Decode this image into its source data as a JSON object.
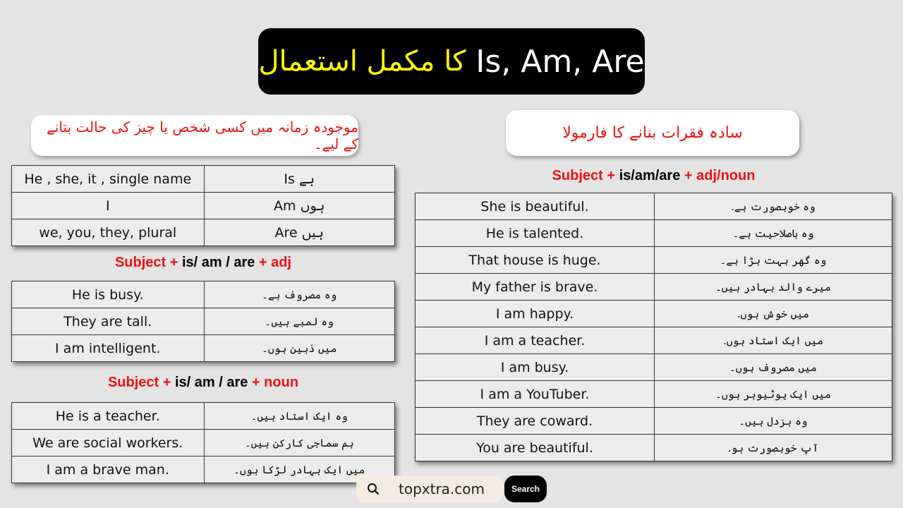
{
  "title": {
    "urdu": "کا مکمل استعمال",
    "english": "Is, Am, Are"
  },
  "left_banner": "موجودہ زمانہ میں کسی شخص یا چیز کی حالت بتانے کے لیے۔",
  "right_banner": "سادہ فقرات بنانے کا فارمولا",
  "usage_table": {
    "rows": [
      {
        "subject": "He , she, it , single name",
        "verb": "Is ہے"
      },
      {
        "subject": "I",
        "verb": "Am ہوں"
      },
      {
        "subject": "we, you, they, plural",
        "verb": "Are ہیں"
      }
    ]
  },
  "adj_section": {
    "formula": {
      "part1": "Subject +",
      "part2": " is/ am / are ",
      "part3": "+ adj"
    },
    "rows": [
      {
        "en": "He is busy.",
        "ur": "وہ مصروف ہے۔"
      },
      {
        "en": "They are tall.",
        "ur": "وہ لمبے ہیں۔"
      },
      {
        "en": "I am intelligent.",
        "ur": "میں ذہین ہوں۔"
      }
    ]
  },
  "noun_section": {
    "formula": {
      "part1": "Subject +",
      "part2": " is/ am / are ",
      "part3": "+ noun"
    },
    "rows": [
      {
        "en": "He is a teacher.",
        "ur": "وہ ایک استاد ہیں۔"
      },
      {
        "en": "We are social workers.",
        "ur": "ہم سماجی کارکن ہیں۔"
      },
      {
        "en": "I am a brave man.",
        "ur": "میں ایک بہادر لڑکا ہوں۔"
      }
    ]
  },
  "examples_section": {
    "formula": {
      "part1": "Subject +",
      "part2": " is/am/are ",
      "part3": "+ adj/noun"
    },
    "rows": [
      {
        "en": "She is beautiful.",
        "ur": "وہ خوبصورت ہے."
      },
      {
        "en": "He is talented.",
        "ur": "وہ باصلاحیت ہے۔"
      },
      {
        "en": "That house is huge.",
        "ur": "وہ گھر بہت بڑا ہے۔"
      },
      {
        "en": "My father is brave.",
        "ur": "میرے والد بہادر ہیں۔"
      },
      {
        "en": "I am happy.",
        "ur": "میں خوش ہوں."
      },
      {
        "en": "I am a teacher.",
        "ur": "میں ایک استاد ہوں."
      },
      {
        "en": "I am busy.",
        "ur": "میں مصروف ہوں۔"
      },
      {
        "en": "I am a YouTuber.",
        "ur": "میں ایک یوٹیوبر ہوں۔"
      },
      {
        "en": "They are coward.",
        "ur": "وہ بزدل ہیں۔"
      },
      {
        "en": "You are beautiful.",
        "ur": "آپ خوبصورت ہو."
      }
    ]
  },
  "search": {
    "value": "topxtra.com",
    "button_label": "Search",
    "icon": "search-icon"
  },
  "colors": {
    "accent_red": "#ee1111",
    "title_yellow": "#ffff00",
    "background": "#e4e4e4"
  }
}
